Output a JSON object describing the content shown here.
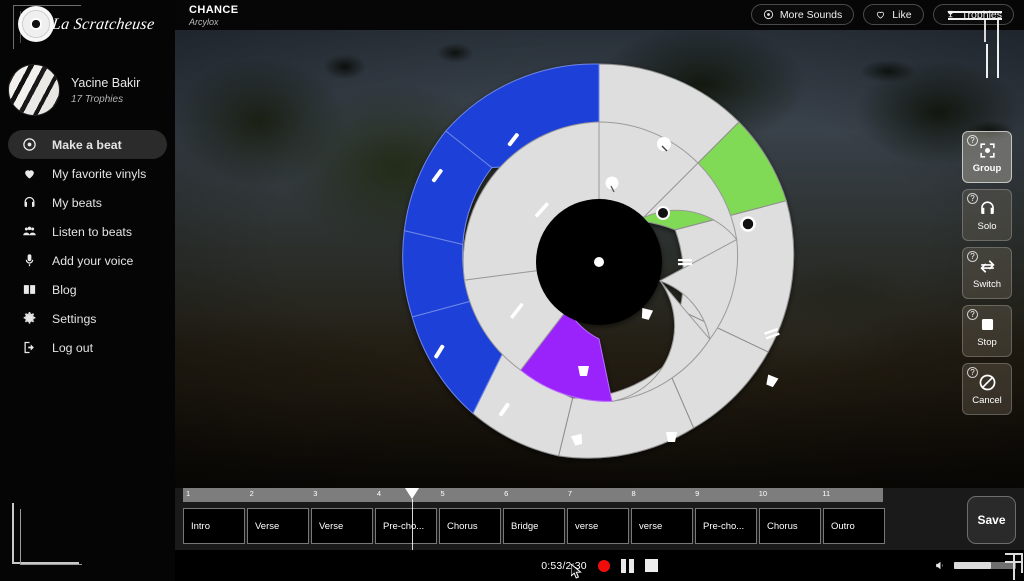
{
  "brand": {
    "name": "La Scratcheuse",
    "logo_icon": "vinyl-record-icon"
  },
  "profile": {
    "name": "Yacine Bakir",
    "trophies": "17 Trophies",
    "avatar_icon": "piano-keys-avatar"
  },
  "sidebar": {
    "items": [
      {
        "label": "Make a beat",
        "icon": "vinyl-record-icon",
        "active": true
      },
      {
        "label": "My favorite vinyls",
        "icon": "heart-icon",
        "active": false
      },
      {
        "label": "My beats",
        "icon": "headphones-icon",
        "active": false
      },
      {
        "label": "Listen to beats",
        "icon": "users-group-icon",
        "active": false
      },
      {
        "label": "Add your voice",
        "icon": "microphone-icon",
        "active": false
      },
      {
        "label": "Blog",
        "icon": "book-open-icon",
        "active": false
      },
      {
        "label": "Settings",
        "icon": "gear-icon",
        "active": false
      },
      {
        "label": "Log out",
        "icon": "logout-arrow-icon",
        "active": false
      }
    ]
  },
  "header": {
    "title": "CHANCE",
    "artist": "Arcylox",
    "buttons": [
      {
        "label": "More Sounds",
        "icon": "disc-icon"
      },
      {
        "label": "Like",
        "icon": "heart-outline-icon"
      },
      {
        "label": "Trophies",
        "icon": "trophy-icon"
      }
    ]
  },
  "tools": [
    {
      "label": "Group",
      "icon": "group-frame-icon",
      "active": true,
      "help": "?"
    },
    {
      "label": "Solo",
      "icon": "headphones-icon",
      "active": false,
      "help": "?"
    },
    {
      "label": "Switch",
      "icon": "swap-arrows-icon",
      "active": false,
      "help": "?"
    },
    {
      "label": "Stop",
      "icon": "stop-square-icon",
      "active": false,
      "help": "?"
    },
    {
      "label": "Cancel",
      "icon": "no-entry-icon",
      "active": false,
      "help": "?"
    }
  ],
  "timeline": {
    "ruler_marks": [
      "1",
      "2",
      "3",
      "4",
      "5",
      "6",
      "7",
      "8",
      "9",
      "10",
      "11"
    ],
    "playhead_bar": 4.6,
    "segments": [
      {
        "label": "Intro"
      },
      {
        "label": "Verse"
      },
      {
        "label": "Verse"
      },
      {
        "label": "Pre-cho..."
      },
      {
        "label": "Chorus"
      },
      {
        "label": "Bridge"
      },
      {
        "label": "verse"
      },
      {
        "label": "verse"
      },
      {
        "label": "Pre-cho..."
      },
      {
        "label": "Chorus"
      },
      {
        "label": "Outro"
      }
    ],
    "save_label": "Save"
  },
  "transport": {
    "time_current": "0:53",
    "time_total": "2:30",
    "time_display": "0:53/2:30",
    "record_icon": "record-dot-icon",
    "pause_icon": "pause-icon",
    "stop_icon": "stop-icon",
    "volume_icon": "volume-icon",
    "volume_level": 60
  },
  "colors": {
    "blue": "#1a3fd8",
    "green": "#80da55",
    "purple": "#9a22fb",
    "light": "#dedede",
    "hub": "#000000",
    "accent_red": "#f20d0d"
  },
  "wheel": {
    "hub_icon": "center-dot-icon",
    "outer_segments": [
      {
        "color": "#dedede",
        "icon": "vinyl-mark-icon"
      },
      {
        "color": "#80da55",
        "icon": "drum-icon"
      },
      {
        "color": "#dedede",
        "icon": "drum-icon"
      },
      {
        "color": "#dedede",
        "icon": "drum-icon"
      },
      {
        "color": "#dedede",
        "icon": "drum-icon"
      },
      {
        "color": "#dedede",
        "icon": "drum-icon"
      },
      {
        "color": "#1a3fd8",
        "icon": "stick-icon"
      },
      {
        "color": "#1a3fd8",
        "icon": "stick-icon"
      },
      {
        "color": "#1a3fd8",
        "icon": "stick-icon"
      },
      {
        "color": "#1a3fd8",
        "icon": "stick-icon"
      }
    ],
    "inner_segments": [
      {
        "color": "#dedede",
        "icon": "dot-icon"
      },
      {
        "color": "#dedede",
        "icon": "dot-icon"
      },
      {
        "color": "#dedede",
        "icon": "line-icon"
      },
      {
        "color": "#dedede",
        "icon": "drum-icon"
      },
      {
        "color": "#9a22fb",
        "icon": "drum-icon"
      },
      {
        "color": "#dedede",
        "icon": "pencil-icon"
      },
      {
        "color": "#dedede",
        "icon": "pencil-icon"
      }
    ]
  }
}
